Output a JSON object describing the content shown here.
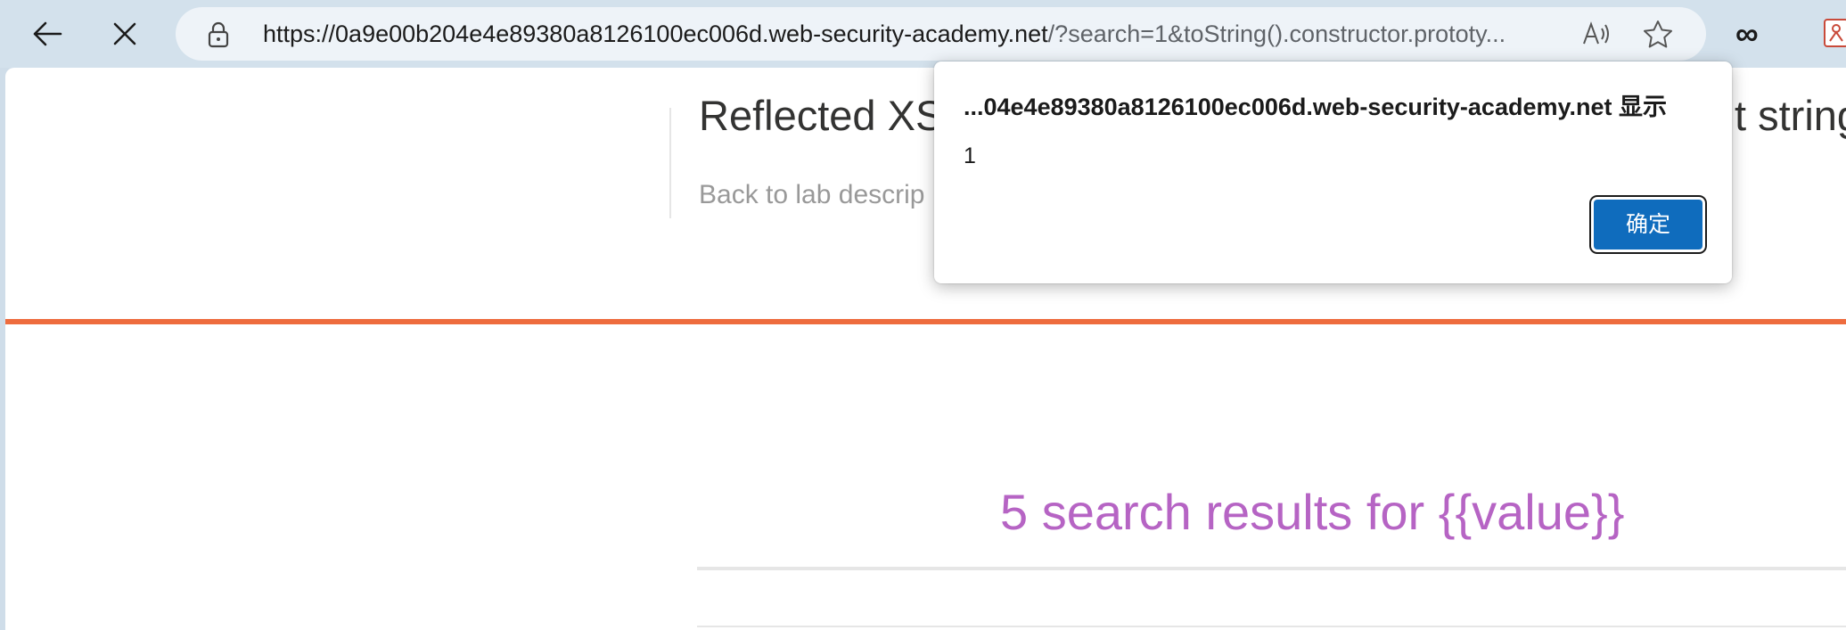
{
  "browser": {
    "url_host": "https://0a9e00b204e4e89380a8126100ec006d.web-security-academy.net",
    "url_rest": "/?search=1&toString().constructor.prototy",
    "url_ellipsis": "...",
    "infinity_glyph": "∞",
    "icons": {
      "back": "arrow-left-icon",
      "stop": "close-icon",
      "lock": "lock-icon",
      "read_aloud": "read-aloud-icon",
      "favorite": "star-icon",
      "extension": "extension-icon"
    }
  },
  "page": {
    "lab_title": "Reflected XS",
    "lab_title_tail": "t string",
    "back_link": "Back to lab descrip",
    "results_heading": "5 search results for {{value}}",
    "colors": {
      "accent_rule": "#ee6c3e",
      "results_heading": "#b664c4"
    }
  },
  "dialog": {
    "origin": "...04e4e89380a8126100ec006d.web-security-academy.net 显示",
    "message": "1",
    "ok_label": "确定",
    "ok_color": "#0f6cbd"
  }
}
